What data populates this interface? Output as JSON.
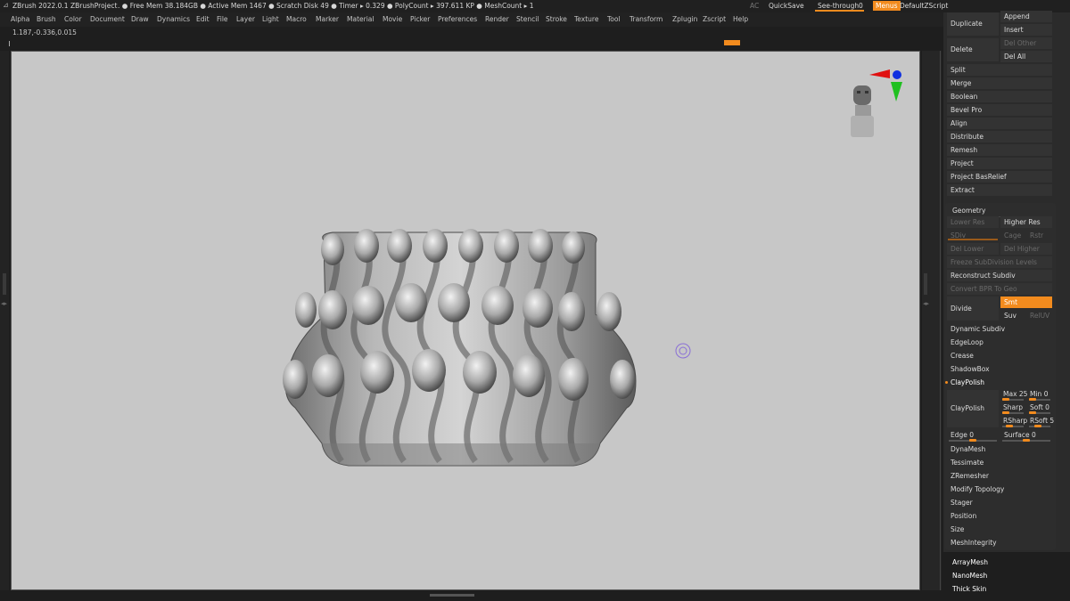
{
  "titlebar": {
    "app": "ZBrush 2022.0.1",
    "project": "ZBrushProject",
    "stats": ". ● Free Mem 38.184GB ● Active Mem 1467 ● Scratch Disk 49 ● Timer ▸ 0.329 ● PolyCount ▸ 397.611 KP ● MeshCount ▸ 1",
    "ac": "AC",
    "quicksave": "QuickSave",
    "seethrough": "See-through",
    "seethrough_value": "0",
    "menus": "Menus",
    "script": "DefaultZScript"
  },
  "menu": [
    "Alpha",
    "Brush",
    "Color",
    "Document",
    "Draw",
    "Dynamics",
    "Edit",
    "File",
    "Layer",
    "Light",
    "Macro",
    "Marker",
    "Material",
    "Movie",
    "Picker",
    "Preferences",
    "Render",
    "Stencil",
    "Stroke",
    "Texture",
    "Tool",
    "Transform",
    "Zplugin",
    "Zscript",
    "Help"
  ],
  "coords": "1.187,-0.336,0.015",
  "subtool": {
    "duplicate": "Duplicate",
    "append": "Append",
    "insert": "Insert",
    "delete": "Delete",
    "del_other": "Del Other",
    "del_all": "Del All",
    "items": [
      "Split",
      "Merge",
      "Boolean",
      "Bevel Pro",
      "Align",
      "Distribute",
      "Remesh",
      "Project",
      "Project BasRelief",
      "Extract"
    ]
  },
  "geometry": {
    "title": "Geometry",
    "lower_res": "Lower Res",
    "higher_res": "Higher Res",
    "sdiv": "SDiv",
    "cage": "Cage",
    "rstr": "Rstr",
    "del_lower": "Del Lower",
    "del_higher": "Del Higher",
    "freeze": "Freeze SubDivision Levels",
    "reconstruct": "Reconstruct Subdiv",
    "convert_bpr": "Convert BPR To Geo",
    "divide": "Divide",
    "smt": "Smt",
    "suv": "Suv",
    "reluv": "RelUV",
    "items": [
      "Dynamic Subdiv",
      "EdgeLoop",
      "Crease",
      "ShadowBox"
    ],
    "claypolish_header": "ClayPolish",
    "claypolish_btn": "ClayPolish",
    "max": "Max 25",
    "min": "Min 0",
    "sharp": "Sharp",
    "soft": "Soft 0",
    "rsharp": "RSharp",
    "rsoft": "RSoft 5",
    "edge": "Edge 0",
    "surface": "Surface 0",
    "items2": [
      "DynaMesh",
      "Tessimate",
      "ZRemesher",
      "Modify Topology",
      "Stager",
      "Position",
      "Size",
      "MeshIntegrity"
    ]
  },
  "extra": [
    "ArrayMesh",
    "NanoMesh",
    "Thick Skin"
  ],
  "colors": {
    "accent": "#f28b1e",
    "canvas": "#c7c7c7",
    "panel": "#2b2b2b"
  }
}
